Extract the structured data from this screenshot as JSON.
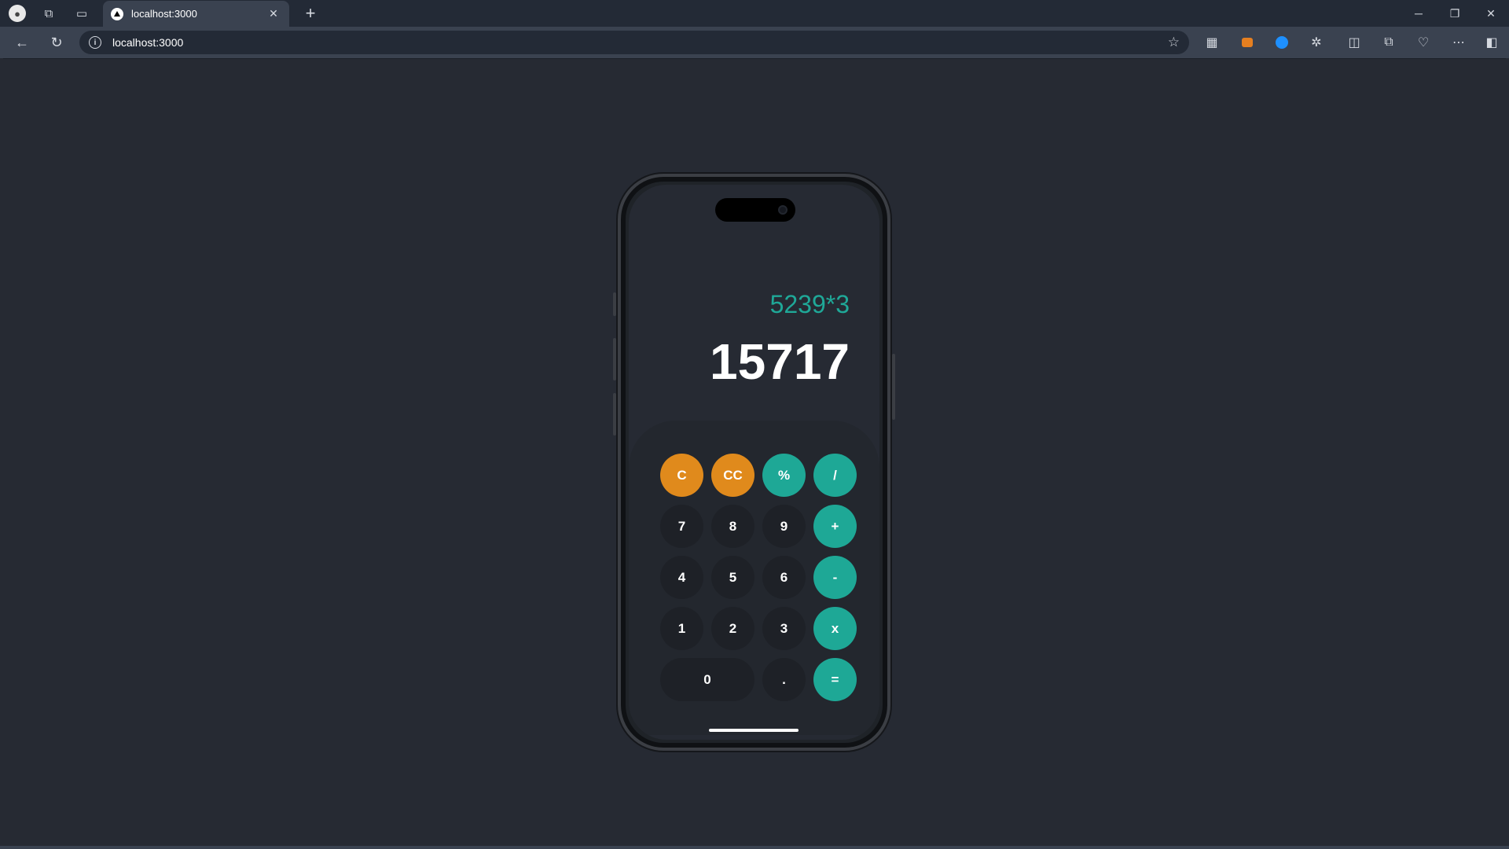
{
  "browser": {
    "tab_title": "localhost:3000",
    "tab_close": "✕",
    "new_tab": "+",
    "url": "localhost:3000",
    "info_icon": "i",
    "star_icon": "☆",
    "window": {
      "minimize": "─",
      "restore": "❐",
      "close": "✕"
    },
    "nav": {
      "back": "←",
      "refresh": "↻"
    },
    "toolbar_icons": {
      "more": "⋯"
    }
  },
  "calculator": {
    "expression": "5239*3",
    "result": "15717",
    "keys": {
      "clear": "C",
      "clear_all": "CC",
      "percent": "%",
      "divide": "/",
      "seven": "7",
      "eight": "8",
      "nine": "9",
      "plus": "+",
      "four": "4",
      "five": "5",
      "six": "6",
      "minus": "-",
      "one": "1",
      "two": "2",
      "three": "3",
      "multiply": "x",
      "zero": "0",
      "dot": ".",
      "equals": "="
    }
  },
  "colors": {
    "accent_teal": "#1ea896",
    "accent_orange": "#e08a1c",
    "background": "#262a33"
  }
}
